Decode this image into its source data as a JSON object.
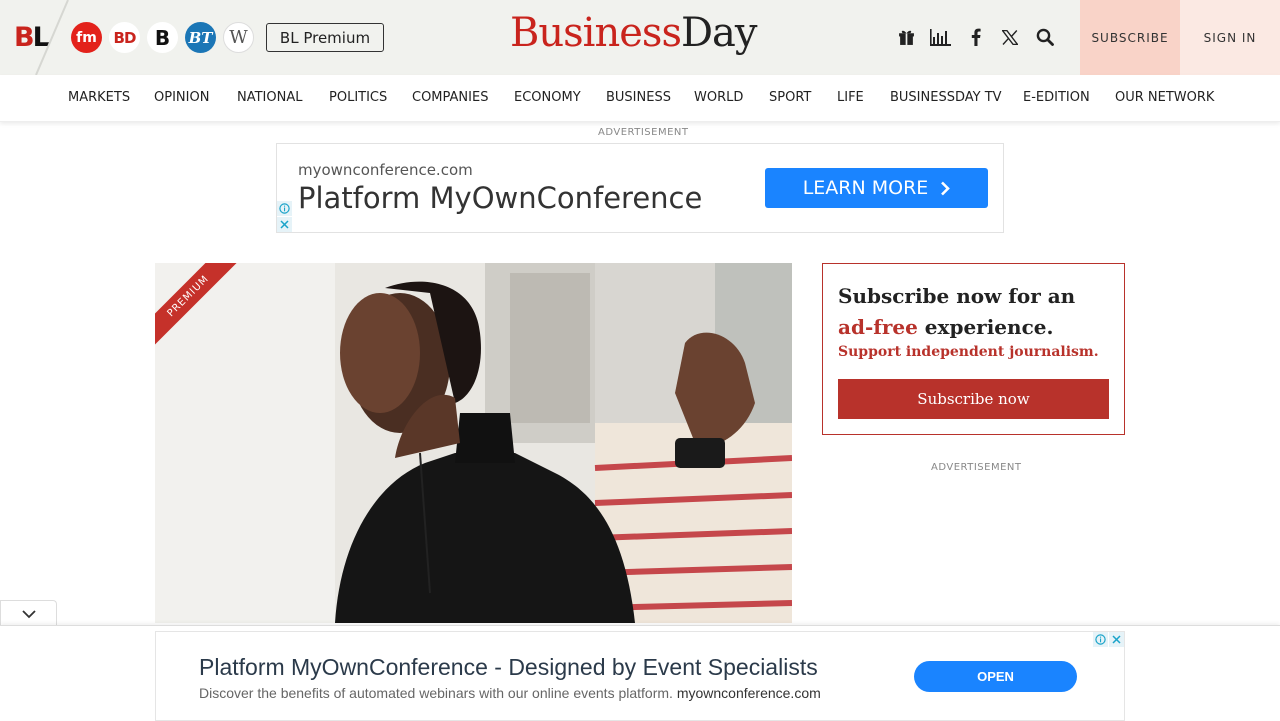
{
  "header": {
    "logo_b": "B",
    "logo_l": "L",
    "publications": [
      {
        "label": "fm",
        "icon": "financial-mail-logo"
      },
      {
        "label": "BD",
        "icon": "business-day-logo"
      },
      {
        "label": "B",
        "icon": "business-logo"
      },
      {
        "label": "BT",
        "icon": "business-times-logo"
      },
      {
        "label": "W",
        "icon": "wanted-logo"
      }
    ],
    "premium_label": "BL Premium",
    "masthead_business": "Business",
    "masthead_day": "Day",
    "icons": [
      "gift-icon",
      "chart-icon",
      "facebook-icon",
      "x-icon",
      "search-icon"
    ],
    "subscribe_label": "SUBSCRIBE",
    "signin_label": "SIGN IN",
    "accent_color": "#c9241d"
  },
  "nav": {
    "items": [
      "MARKETS",
      "OPINION",
      "NATIONAL",
      "POLITICS",
      "COMPANIES",
      "ECONOMY",
      "BUSINESS",
      "WORLD",
      "SPORT",
      "LIFE",
      "BUSINESSDAY TV",
      "E-EDITION",
      "OUR NETWORK"
    ]
  },
  "top_ad": {
    "label": "ADVERTISEMENT",
    "domain": "myownconference.com",
    "headline": "Platform MyOwnConference",
    "cta": "LEARN MORE"
  },
  "article": {
    "ribbon": "PREMIUM"
  },
  "sidebar": {
    "title_part1": "Subscribe now for an ",
    "title_red": "ad-free",
    "title_part2": " experience.",
    "support": "Support independent journalism.",
    "button": "Subscribe now",
    "ad_label": "ADVERTISEMENT"
  },
  "bottom_ad": {
    "headline": "Platform MyOwnConference - Designed by Event Specialists",
    "desc": "Discover the benefits of automated webinars with our online events platform.",
    "domain": "myownconference.com",
    "cta": "OPEN"
  }
}
